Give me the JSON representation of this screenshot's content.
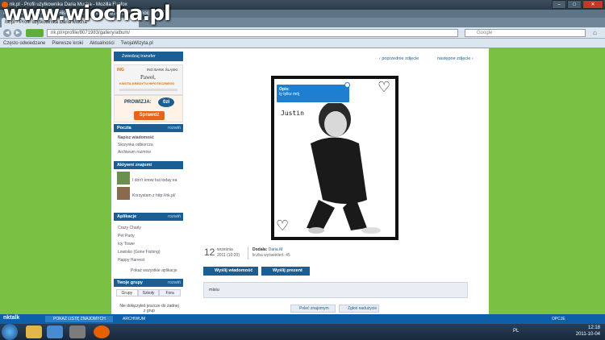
{
  "browser": {
    "window_title": "nk.pl - Profil użytkownika Daria Mucha - Mozilla Firefox",
    "menu": [
      "Plik",
      "Edycja",
      "Widok",
      "Historia",
      "Zakładki",
      "Narzędzia",
      "Pomoc"
    ],
    "tab_title": "nk.pl - Profil użytkownika Daria Mucha",
    "url": "nk.pl/#profile/8071983/gallery/album/",
    "url_domain": "nk.pl",
    "search_placeholder": "Google",
    "bookmarks": [
      "Często odwiedzane",
      "Pierwsze kroki",
      "Aktualności",
      "TwojaWizyta.pl"
    ]
  },
  "watermark": "www.wiocha.pl",
  "sidebar": {
    "top_link": "Zwiedzaj transfer",
    "bank_name": "ING BANK ŚLĄSKI",
    "ad_name": "Paweł,",
    "ad_line": "KWOTA KREDYTU HIPOTECZNEGO",
    "prowizja": "PROWIZJA:",
    "prowizja_val": "0zł",
    "check_btn": "Sprawdź",
    "poczta": "Poczta",
    "more": "rozwiń",
    "poczta_items": [
      "Napisz wiadomość",
      "Skrzynka odbiorcza",
      "Archiwum rozmów"
    ],
    "friends": "Aktywni znajomi",
    "friend_msgs": [
      "I don't know but today ea",
      "Korzystam z http://nk.pl/"
    ],
    "apps": "Aplikacje",
    "app_items": [
      "Crazy Charly",
      "Pet Party",
      "Icy Tower",
      "Lowisko (Gone Fishing)",
      "Happy Harvest"
    ],
    "apps_all": "Pokaż wszystkie aplikacje",
    "groups": "Twoje grupy",
    "group_tabs": [
      "Grupy",
      "Szkoły",
      "Fora"
    ],
    "groups_empty": "Nie dołączyłeś jeszcze do żadnej z grup"
  },
  "main": {
    "prev": "poprzednie zdjęcie",
    "next": "następne zdjęcie",
    "opis_label": "Opis:",
    "opis_text": "ty tylko mój",
    "photo_caption": "Justin",
    "date_day": "12",
    "date_month": "września",
    "date_year": "2011 (10:20)",
    "added_label": "Dodała:",
    "added_by": "Daria M",
    "views": "liczba wyświetleń: 45",
    "btn_message": "Wyślij wiadomość",
    "btn_gift": "Wyślij prezent",
    "message": "misiu",
    "btn_poke": "Poleć znajomym",
    "btn_report": "Zgłoś nadużycie"
  },
  "nktalk": {
    "logo": "nktalk",
    "list": "POKAŻ LISTĘ ZNAJOMYCH",
    "archive": "ARCHIWUM",
    "options": "OPCJE"
  },
  "taskbar": {
    "lang": "PL",
    "time": "12:18",
    "date": "2011-10-04"
  }
}
